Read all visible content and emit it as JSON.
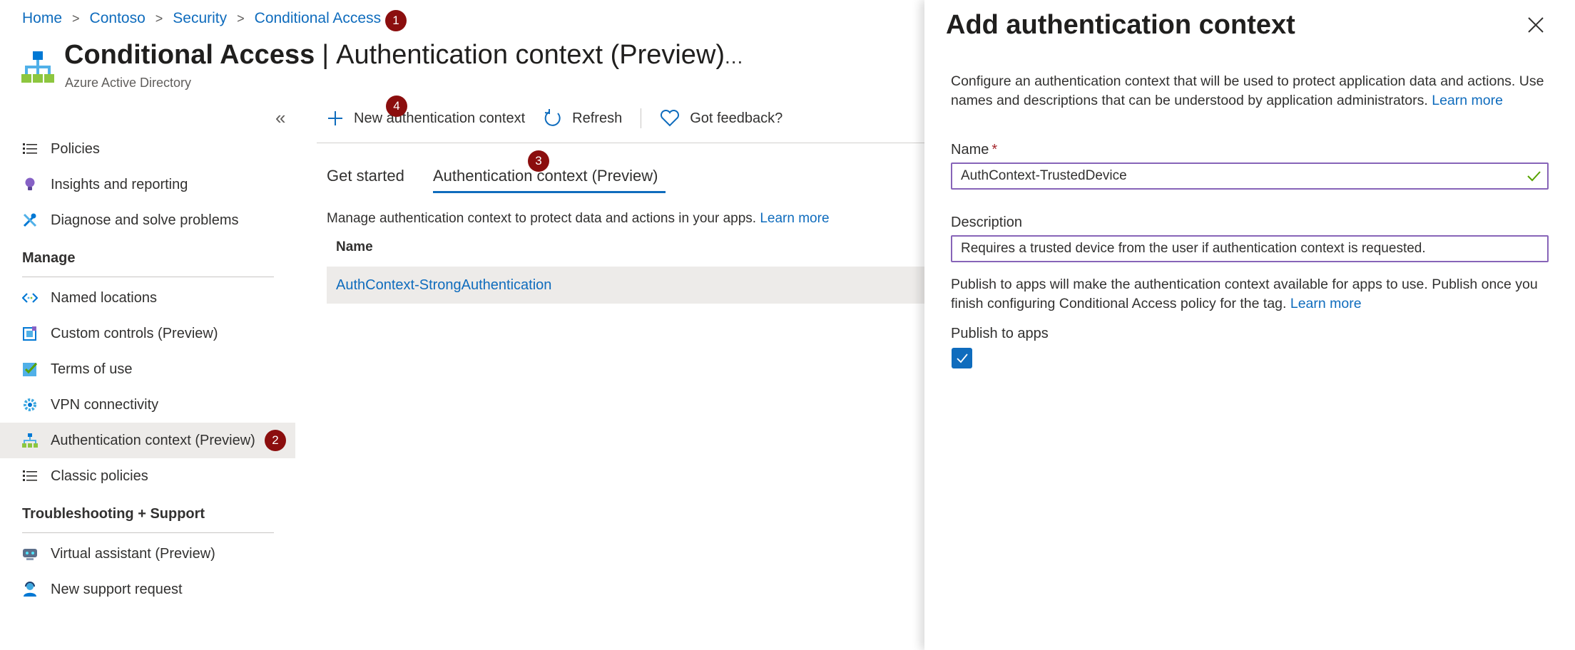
{
  "breadcrumb": [
    {
      "label": "Home"
    },
    {
      "label": "Contoso"
    },
    {
      "label": "Security"
    },
    {
      "label": "Conditional Access"
    }
  ],
  "header": {
    "title": "Conditional Access",
    "subtitle_title": "Authentication context (Preview)",
    "subtitle": "Azure Active Directory",
    "more": "..."
  },
  "badges": {
    "b1": "1",
    "b2": "2",
    "b3": "3",
    "b4": "4"
  },
  "sidebar": {
    "collapse": "«",
    "top_items": [
      {
        "label": "Policies",
        "icon": "list-icon"
      },
      {
        "label": "Insights and reporting",
        "icon": "lightbulb-icon"
      },
      {
        "label": "Diagnose and solve problems",
        "icon": "wrench-icon"
      }
    ],
    "manage_heading": "Manage",
    "manage_items": [
      {
        "label": "Named locations",
        "icon": "location-code-icon"
      },
      {
        "label": "Custom controls (Preview)",
        "icon": "custom-control-icon"
      },
      {
        "label": "Terms of use",
        "icon": "checklist-icon"
      },
      {
        "label": "VPN connectivity",
        "icon": "gear-icon"
      },
      {
        "label": "Authentication context (Preview)",
        "icon": "hierarchy-icon",
        "active": true
      },
      {
        "label": "Classic policies",
        "icon": "list-icon"
      }
    ],
    "support_heading": "Troubleshooting + Support",
    "support_items": [
      {
        "label": "Virtual assistant (Preview)",
        "icon": "assistant-icon"
      },
      {
        "label": "New support request",
        "icon": "support-person-icon"
      }
    ]
  },
  "commands": {
    "new_context": "New authentication context",
    "refresh": "Refresh",
    "feedback": "Got feedback?"
  },
  "tabs": [
    {
      "label": "Get started"
    },
    {
      "label": "Authentication context (Preview)",
      "selected": true
    }
  ],
  "content": {
    "description": "Manage authentication context to protect data and actions in your apps.",
    "learn_more": "Learn more",
    "column_name": "Name",
    "rows": [
      "AuthContext-StrongAuthentication"
    ]
  },
  "panel": {
    "title": "Add authentication context",
    "intro": "Configure an authentication context that will be used to protect application data and actions. Use names and descriptions that can be understood by application administrators.",
    "intro_link": "Learn more",
    "name_label": "Name",
    "required_mark": "*",
    "name_value": "AuthContext-TrustedDevice",
    "description_label": "Description",
    "description_value": "Requires a trusted device from the user if authentication context is requested.",
    "publish_text": "Publish to apps will make the authentication context available for apps to use. Publish once you finish configuring Conditional Access policy for the tag.",
    "publish_link": "Learn more",
    "publish_label": "Publish to apps",
    "publish_checked": true
  },
  "colors": {
    "accent": "#0f6cbd",
    "badge": "#8b0e0e",
    "field_border": "#8764b8",
    "valid": "#57a300"
  }
}
